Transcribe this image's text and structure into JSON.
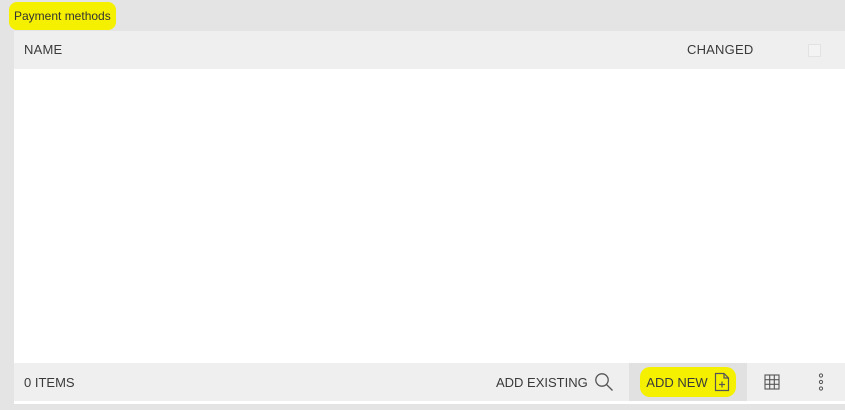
{
  "panel": {
    "title": "Payment methods"
  },
  "grid": {
    "columns": [
      "NAME",
      "CHANGED"
    ],
    "rows": []
  },
  "footer": {
    "item_count": "0 ITEMS",
    "add_existing_label": "ADD EXISTING",
    "add_new_label": "ADD NEW"
  },
  "icons": {
    "add_existing": "search-icon",
    "add_new": "new-document-icon",
    "grid_view": "grid-icon",
    "more": "more-vertical-icon"
  },
  "colors": {
    "highlight": "#f4f000",
    "background": "#e4e4e4",
    "header": "#efefef"
  }
}
